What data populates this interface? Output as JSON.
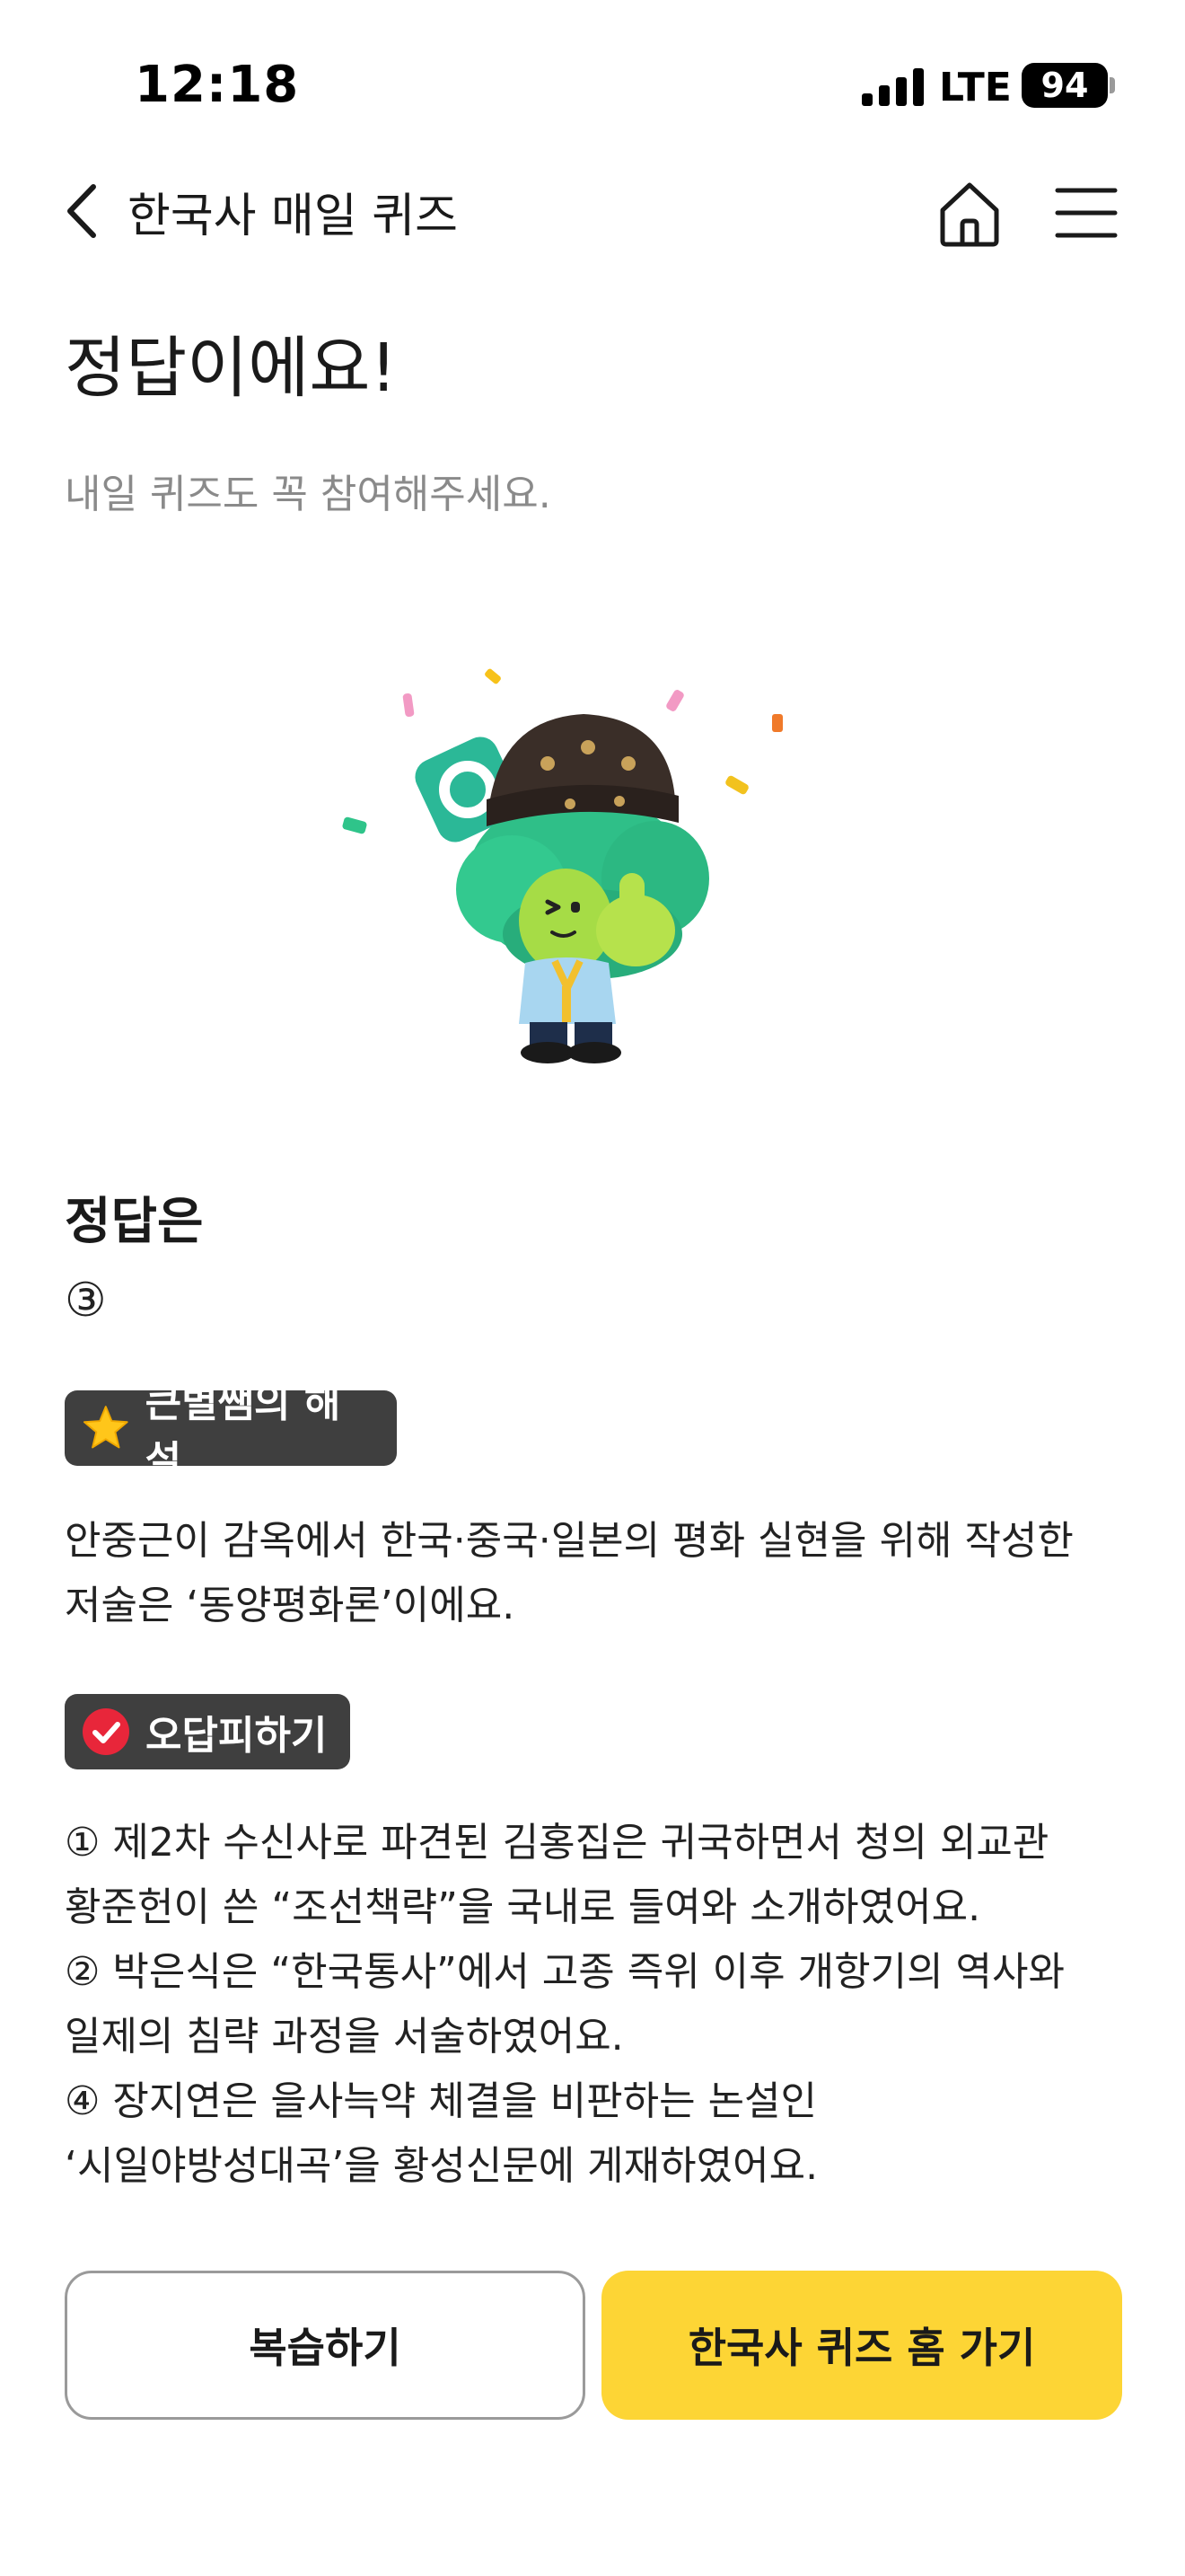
{
  "status_bar": {
    "time": "12:18",
    "network": "LTE",
    "battery": "94"
  },
  "header": {
    "title": "한국사 매일 퀴즈",
    "back_icon": "chevron-left-icon",
    "home_icon": "home-icon",
    "menu_icon": "hamburger-menu-icon"
  },
  "result": {
    "title": "정답이에요!",
    "subtitle": "내일 퀴즈도 꼭 참여해주세요.",
    "illustration": "mascot-thumbs-up-correct-illustration"
  },
  "answer": {
    "label": "정답은",
    "value": "③"
  },
  "explanation": {
    "badge_label": "큰별쌤의 해설",
    "badge_icon": "star-icon",
    "lines": [
      "안중근이 감옥에서 한국·중국·일본의 평화 실현을 위해 작성한",
      "저술은 ‘동양평화론’이에요."
    ]
  },
  "wrong_answers": {
    "badge_label": "오답피하기",
    "badge_icon": "check-circle-icon",
    "lines": [
      "① 제2차 수신사로 파견된 김홍집은 귀국하면서 청의 외교관",
      "황준헌이 쓴 “조선책략”을 국내로 들여와 소개하였어요.",
      "② 박은식은 “한국통사”에서 고종 즉위 이후 개항기의 역사와",
      "일제의 침략 과정을 서술하였어요.",
      "④ 장지연은 을사늑약 체결을 비판하는 논설인",
      "‘시일야방성대곡’을 황성신문에 게재하였어요."
    ]
  },
  "buttons": {
    "review_label": "복습하기",
    "home_label": "한국사 퀴즈 홈 가기"
  },
  "colors": {
    "accent_yellow": "#fdd535",
    "badge_dark": "#3f3f3f",
    "check_red": "#e8263a",
    "star_yellow": "#ffc61a",
    "subtitle_gray": "#8a8a8a"
  }
}
